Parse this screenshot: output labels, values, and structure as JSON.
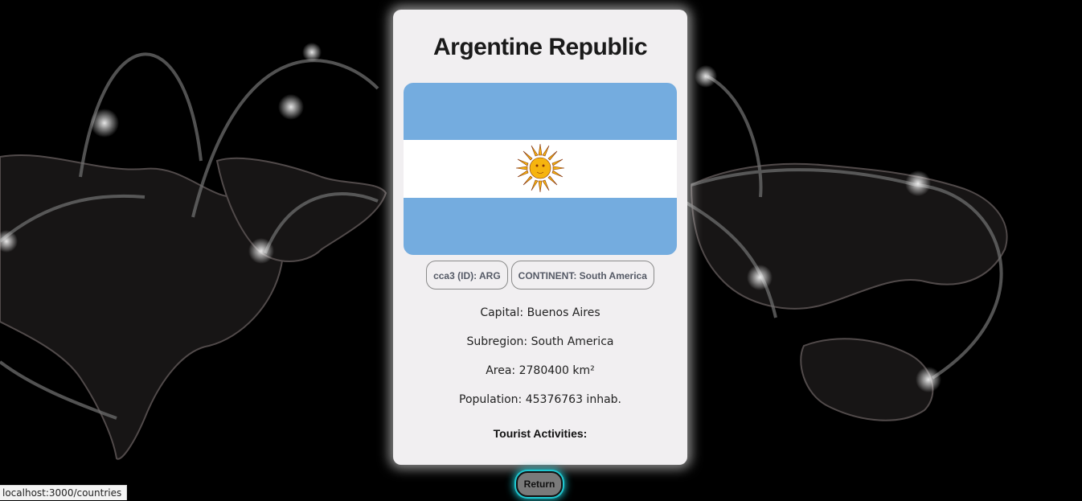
{
  "country": {
    "name": "Argentine Republic",
    "chips": {
      "id": "cca3 (ID): ARG",
      "continent": "CONTINENT: South America"
    },
    "capital": "Capital: Buenos Aires",
    "subregion": "Subregion: South America",
    "area": "Area: 2780400 km²",
    "population": "Population: 45376763 inhab.",
    "tourist_heading": "Tourist Activities:",
    "flag_colors": {
      "blue": "#74acdf",
      "white": "#ffffff",
      "sun": "#f6b40e"
    }
  },
  "actions": {
    "return_label": "Return"
  },
  "status_bar": {
    "url": "localhost:3000/countries"
  },
  "theme": {
    "glow": "#1fc7d0",
    "card_bg": "#f1eff1"
  }
}
